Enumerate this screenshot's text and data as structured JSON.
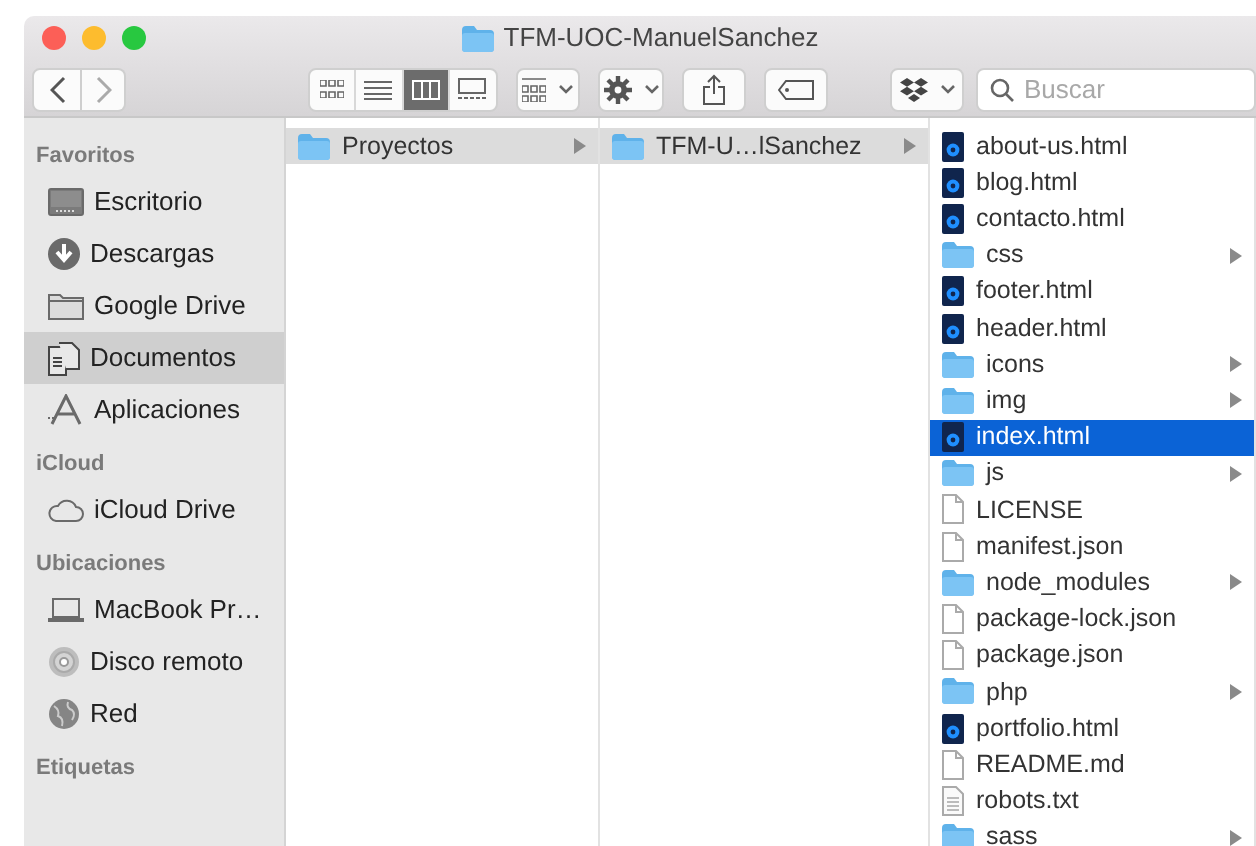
{
  "window": {
    "title": "TFM-UOC-ManuelSanchez"
  },
  "toolbar": {
    "view_modes": [
      {
        "kind": "icons",
        "selected": false
      },
      {
        "kind": "list",
        "selected": false
      },
      {
        "kind": "columns",
        "selected": true
      },
      {
        "kind": "gallery",
        "selected": false
      }
    ],
    "search": {
      "placeholder": "Buscar"
    }
  },
  "sidebar": {
    "sections": [
      {
        "title": "Favoritos",
        "items": [
          {
            "label": "Escritorio",
            "kind": "desktop",
            "selected": false
          },
          {
            "label": "Descargas",
            "kind": "downloads",
            "selected": false
          },
          {
            "label": "Google Drive",
            "kind": "folder",
            "selected": false
          },
          {
            "label": "Documentos",
            "kind": "documents",
            "selected": true
          },
          {
            "label": "Aplicaciones",
            "kind": "apps",
            "selected": false
          }
        ]
      },
      {
        "title": "iCloud",
        "items": [
          {
            "label": "iCloud Drive",
            "kind": "cloud",
            "selected": false
          }
        ]
      },
      {
        "title": "Ubicaciones",
        "items": [
          {
            "label": "MacBook Pr…",
            "kind": "laptop",
            "selected": false
          },
          {
            "label": "Disco remoto",
            "kind": "disc",
            "selected": false
          },
          {
            "label": "Red",
            "kind": "network",
            "selected": false
          }
        ]
      },
      {
        "title": "Etiquetas"
      }
    ]
  },
  "columns": [
    {
      "focused": false,
      "items": [
        {
          "name": "Proyectos",
          "kind": "folder",
          "selected": true
        }
      ]
    },
    {
      "focused": false,
      "items": [
        {
          "name": "TFM-U…lSanchez",
          "kind": "folder",
          "selected": true
        }
      ]
    },
    {
      "focused": true,
      "items": [
        {
          "name": "about-us.html",
          "kind": "html",
          "selected": false
        },
        {
          "name": "blog.html",
          "kind": "html",
          "selected": false
        },
        {
          "name": "contacto.html",
          "kind": "html",
          "selected": false
        },
        {
          "name": "css",
          "kind": "folder",
          "selected": false
        },
        {
          "name": "footer.html",
          "kind": "html",
          "selected": false
        },
        {
          "name": "header.html",
          "kind": "html",
          "selected": false
        },
        {
          "name": "icons",
          "kind": "folder",
          "selected": false
        },
        {
          "name": "img",
          "kind": "folder",
          "selected": false
        },
        {
          "name": "index.html",
          "kind": "html",
          "selected": true
        },
        {
          "name": "js",
          "kind": "folder",
          "selected": false
        },
        {
          "name": "LICENSE",
          "kind": "file",
          "selected": false
        },
        {
          "name": "manifest.json",
          "kind": "file",
          "selected": false
        },
        {
          "name": "node_modules",
          "kind": "folder",
          "selected": false
        },
        {
          "name": "package-lock.json",
          "kind": "file",
          "selected": false
        },
        {
          "name": "package.json",
          "kind": "file",
          "selected": false
        },
        {
          "name": "php",
          "kind": "folder",
          "selected": false
        },
        {
          "name": "portfolio.html",
          "kind": "html",
          "selected": false
        },
        {
          "name": "README.md",
          "kind": "file",
          "selected": false
        },
        {
          "name": "robots.txt",
          "kind": "text",
          "selected": false
        },
        {
          "name": "sass",
          "kind": "folder",
          "selected": false
        }
      ]
    }
  ]
}
